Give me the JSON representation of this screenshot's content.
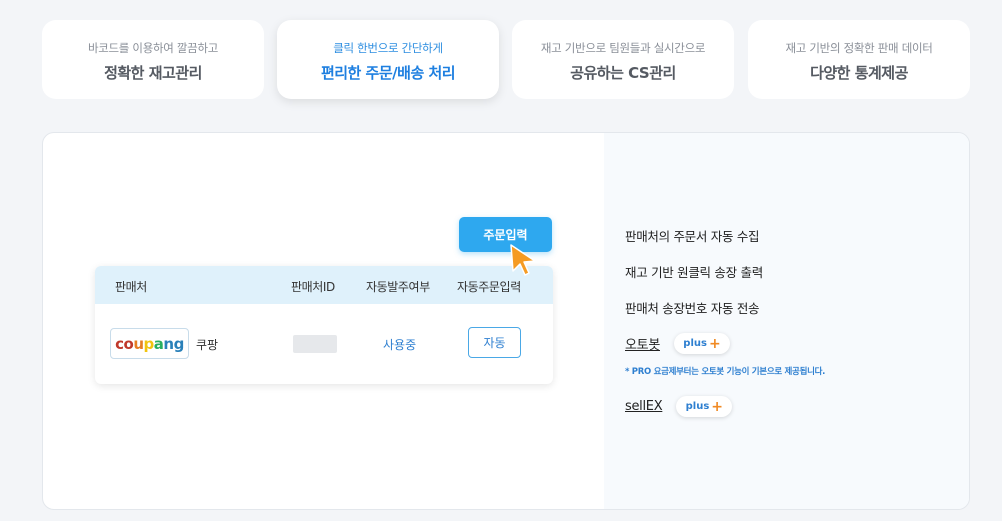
{
  "tabs": [
    {
      "sub": "바코드를 이용하여 깔끔하고",
      "main": "정확한 재고관리"
    },
    {
      "sub": "클릭 한번으로 간단하게",
      "main": "편리한 주문/배송 처리"
    },
    {
      "sub": "재고 기반으로 팀원들과 실시간으로",
      "main": "공유하는 CS관리"
    },
    {
      "sub": "재고 기반의 정확한 판매 데이터",
      "main": "다양한 통계제공"
    }
  ],
  "active_tab_index": 1,
  "order_button": "주문입력",
  "table": {
    "headers": [
      "판매처",
      "판매처ID",
      "자동발주여부",
      "자동주문입력"
    ],
    "row": {
      "logo_parts": [
        "co",
        "u",
        "p",
        "a",
        "ng"
      ],
      "store": "쿠팡",
      "status": "사용중",
      "auto_button": "자동"
    }
  },
  "features": [
    "판매처의 주문서 자동 수집",
    "재고 기반 원클릭 송장 출력",
    "판매처 송장번호 자동 전송"
  ],
  "links": [
    {
      "label": "오토봇",
      "badge": "plus",
      "badge_symbol": "+"
    },
    {
      "label": "sellEX",
      "badge": "plus",
      "badge_symbol": "+"
    }
  ],
  "note": "* PRO 요금제부터는 오토봇 기능이 기본으로 제공됩니다.",
  "colors": {
    "accent": "#2ea8ef",
    "link_blue": "#2e7fd0",
    "plus_orange": "#f08a24"
  }
}
